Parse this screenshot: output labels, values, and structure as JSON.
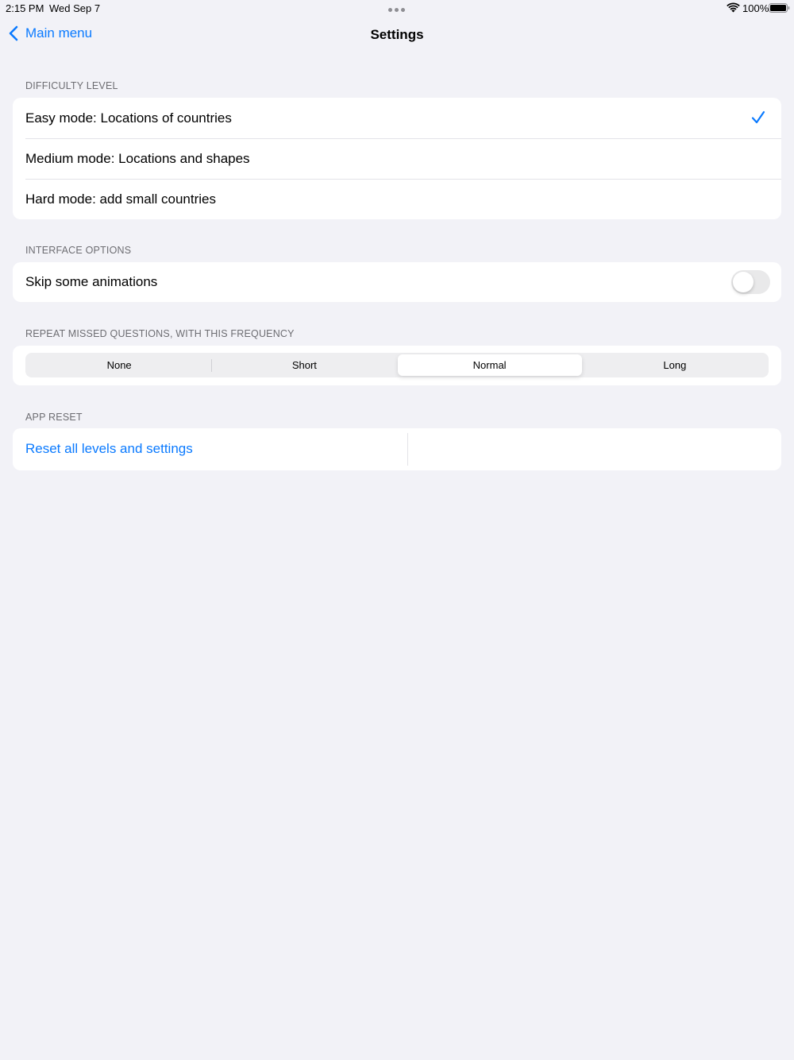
{
  "status_bar": {
    "time": "2:15 PM",
    "date": "Wed Sep 7",
    "battery": "100%"
  },
  "nav": {
    "back_label": "Main menu",
    "title": "Settings"
  },
  "difficulty": {
    "header": "DIFFICULTY LEVEL",
    "items": [
      {
        "label": "Easy mode: Locations of countries",
        "selected": true
      },
      {
        "label": "Medium mode: Locations and shapes",
        "selected": false
      },
      {
        "label": "Hard mode: add small countries",
        "selected": false
      }
    ]
  },
  "interface": {
    "header": "INTERFACE OPTIONS",
    "skip_animations_label": "Skip some animations",
    "skip_animations_on": false
  },
  "repeat": {
    "header": "REPEAT MISSED QUESTIONS, WITH THIS FREQUENCY",
    "options": [
      "None",
      "Short",
      "Normal",
      "Long"
    ],
    "selected": "Normal"
  },
  "reset": {
    "header": "APP RESET",
    "label": "Reset all levels and settings"
  },
  "colors": {
    "accent": "#0a7aff",
    "background": "#f2f2f7",
    "secondary_text": "#6d6d72"
  }
}
